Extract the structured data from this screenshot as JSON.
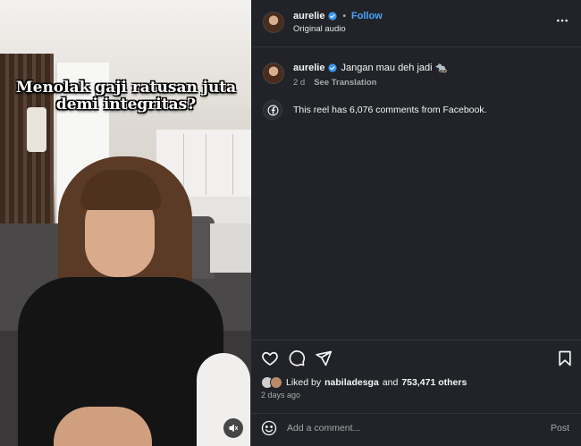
{
  "video": {
    "caption_line1": "Menolak gaji ratusan juta",
    "caption_line2": "demi integritas?",
    "mute_icon": "speaker-muted-icon"
  },
  "header": {
    "username": "aurelie",
    "separator": "•",
    "follow_label": "Follow",
    "audio_label": "Original audio",
    "more_icon": "more-options-icon"
  },
  "post": {
    "username": "aurelie",
    "text": "Jangan mau deh jadi 🐀",
    "time": "2 d",
    "translate_label": "See Translation"
  },
  "facebook_notice": {
    "text": "This reel has 6,076 comments from Facebook.",
    "icon": "facebook-icon"
  },
  "actions": {
    "like_icon": "heart-icon",
    "comment_icon": "comment-icon",
    "share_icon": "send-icon",
    "save_icon": "bookmark-icon"
  },
  "likes": {
    "prefix": "Liked by",
    "user": "nabiladesga",
    "conjunction": "and",
    "others": "753,471 others"
  },
  "timestamp": "2 days ago",
  "comment_box": {
    "placeholder": "Add a comment...",
    "post_label": "Post",
    "emoji_icon": "emoji-icon"
  },
  "colors": {
    "panel_bg": "#212328",
    "accent": "#4aa3ff",
    "verified": "#3897f0",
    "muted_text": "#a8a8a8"
  }
}
